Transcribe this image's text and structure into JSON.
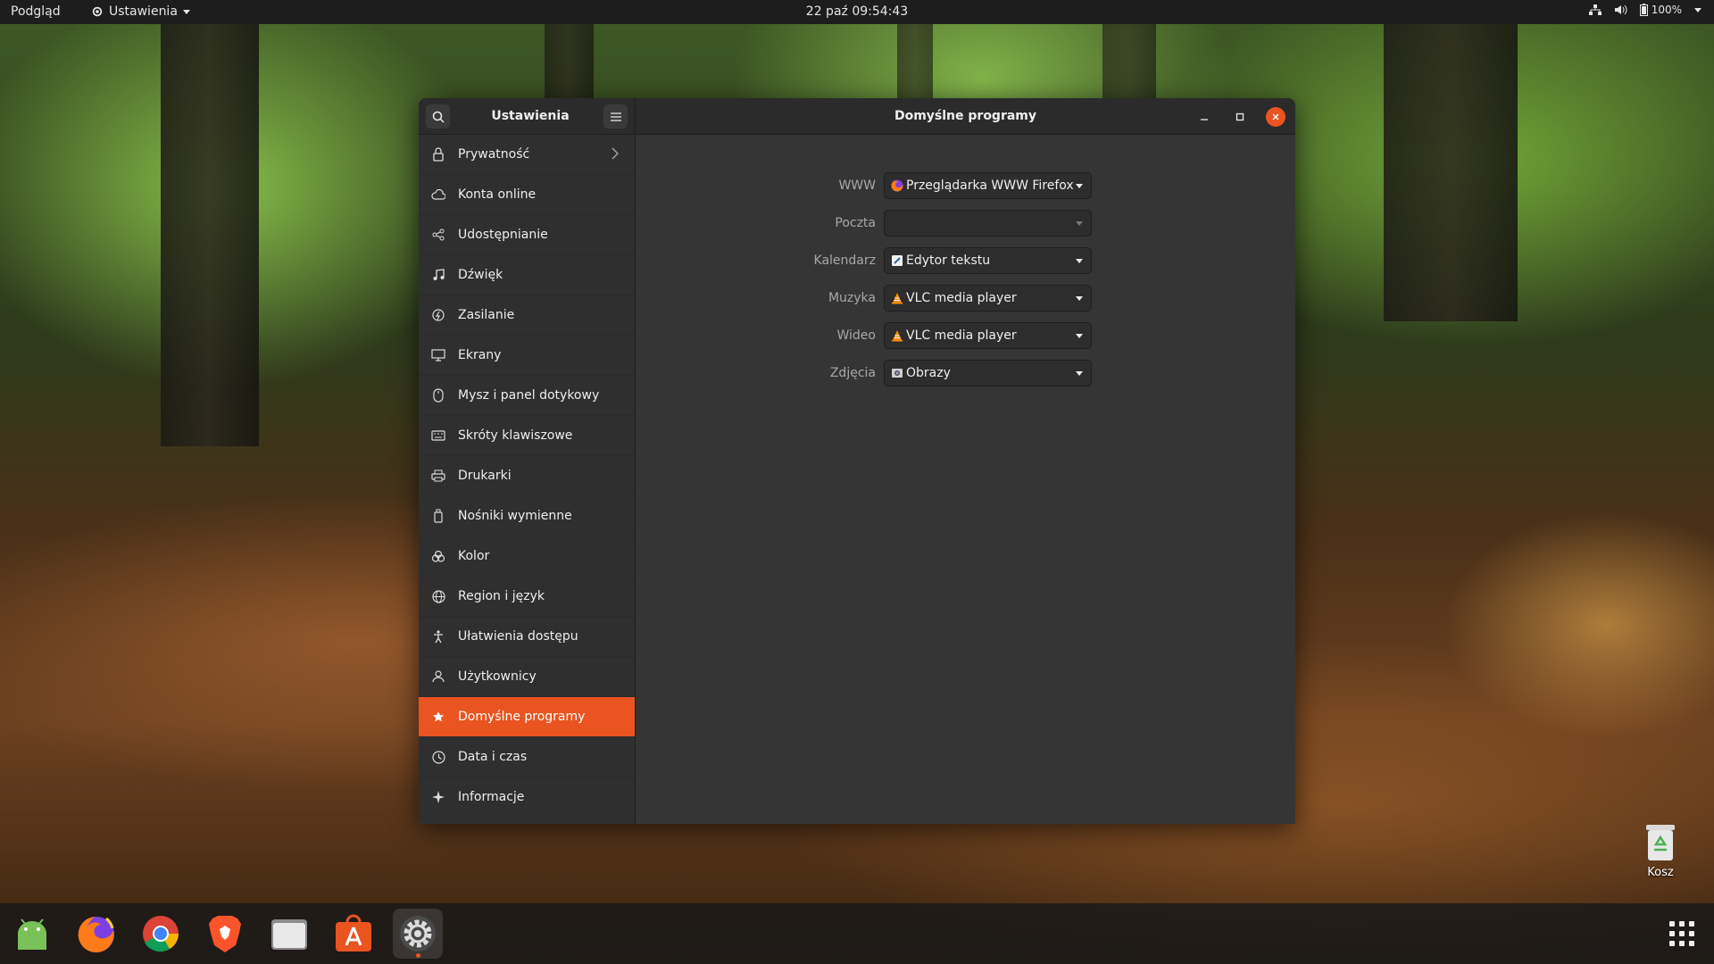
{
  "topbar": {
    "activities": "Podgląd",
    "app_menu": "Ustawienia",
    "clock": "22 paź  09:54:43",
    "battery": "100%"
  },
  "window": {
    "sidebar_title": "Ustawienia",
    "title": "Domyślne programy"
  },
  "sidebar": {
    "items": [
      {
        "label": "Prywatność",
        "icon": "lock-icon"
      },
      {
        "label": "Konta online",
        "icon": "cloud-icon"
      },
      {
        "label": "Udostępnianie",
        "icon": "share-icon"
      },
      {
        "label": "Dźwięk",
        "icon": "music-note-icon"
      },
      {
        "label": "Zasilanie",
        "icon": "power-icon"
      },
      {
        "label": "Ekrany",
        "icon": "display-icon"
      },
      {
        "label": "Mysz i panel dotykowy",
        "icon": "mouse-icon"
      },
      {
        "label": "Skróty klawiszowe",
        "icon": "keyboard-icon"
      },
      {
        "label": "Drukarki",
        "icon": "printer-icon"
      },
      {
        "label": "Nośniki wymienne",
        "icon": "removable-media-icon"
      },
      {
        "label": "Kolor",
        "icon": "color-icon"
      },
      {
        "label": "Region i język",
        "icon": "globe-icon"
      },
      {
        "label": "Ułatwienia dostępu",
        "icon": "accessibility-icon"
      },
      {
        "label": "Użytkownicy",
        "icon": "users-icon"
      },
      {
        "label": "Domyślne programy",
        "icon": "star-icon",
        "active": true
      },
      {
        "label": "Data i czas",
        "icon": "clock-icon"
      },
      {
        "label": "Informacje",
        "icon": "sparkle-icon"
      }
    ]
  },
  "defaults": [
    {
      "label": "WWW",
      "value": "Przeglądarka WWW Firefox",
      "icon": "firefox-icon"
    },
    {
      "label": "Poczta",
      "value": "",
      "icon": ""
    },
    {
      "label": "Kalendarz",
      "value": "Edytor tekstu",
      "icon": "text-editor-icon"
    },
    {
      "label": "Muzyka",
      "value": "VLC media player",
      "icon": "vlc-icon"
    },
    {
      "label": "Wideo",
      "value": "VLC media player",
      "icon": "vlc-icon"
    },
    {
      "label": "Zdjęcia",
      "value": "Obrazy",
      "icon": "image-viewer-icon"
    }
  ],
  "desktop": {
    "trash_label": "Kosz"
  },
  "colors": {
    "accent": "#e95420",
    "window_bg": "#353535",
    "sidebar_bg": "#2f2f2f"
  }
}
